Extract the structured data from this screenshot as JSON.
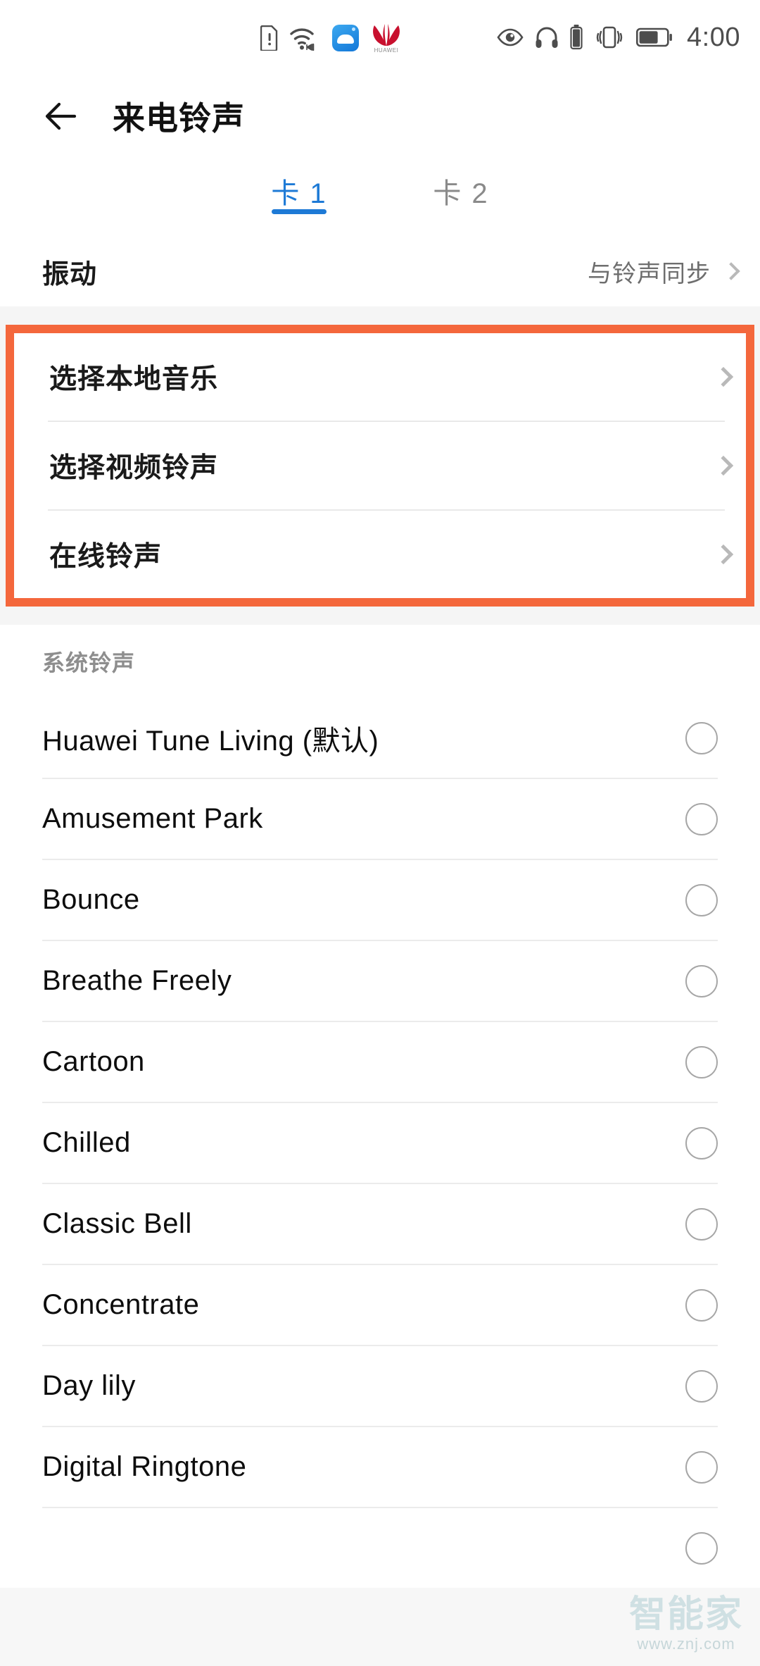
{
  "status_bar": {
    "time": "4:00",
    "left_icons": [
      "sim-alert-icon",
      "wifi-4g-icon",
      "cloud-app-icon",
      "huawei-logo-icon"
    ],
    "right_icons": [
      "eye-comfort-icon",
      "headphones-icon",
      "headphone-battery-icon",
      "vibrate-icon",
      "battery-icon"
    ],
    "huawei_label": "HUAWEI"
  },
  "header": {
    "back_icon": "back-arrow-icon",
    "title": "来电铃声"
  },
  "tabs": [
    {
      "label": "卡 1",
      "active": true
    },
    {
      "label": "卡 2",
      "active": false
    }
  ],
  "vibration": {
    "label": "振动",
    "value": "与铃声同步"
  },
  "highlight": {
    "border_color": "#F4673C",
    "items": [
      {
        "label": "选择本地音乐"
      },
      {
        "label": "选择视频铃声"
      },
      {
        "label": "在线铃声"
      }
    ]
  },
  "system_section": {
    "header": "系统铃声",
    "ringtones": [
      {
        "name": "Huawei Tune Living (默认)",
        "selected": false
      },
      {
        "name": "Amusement Park",
        "selected": false
      },
      {
        "name": "Bounce",
        "selected": false
      },
      {
        "name": "Breathe Freely",
        "selected": false
      },
      {
        "name": "Cartoon",
        "selected": false
      },
      {
        "name": "Chilled",
        "selected": false
      },
      {
        "name": "Classic Bell",
        "selected": false
      },
      {
        "name": "Concentrate",
        "selected": false
      },
      {
        "name": "Day lily",
        "selected": false
      },
      {
        "name": "Digital Ringtone",
        "selected": false
      }
    ]
  },
  "watermark": {
    "main": "智能家",
    "sub": "www.znj.com",
    "color": "#cfe0e3"
  },
  "colors": {
    "accent_blue": "#1e7ad6",
    "highlight_orange": "#F4673C",
    "background": "#f5f5f5"
  }
}
